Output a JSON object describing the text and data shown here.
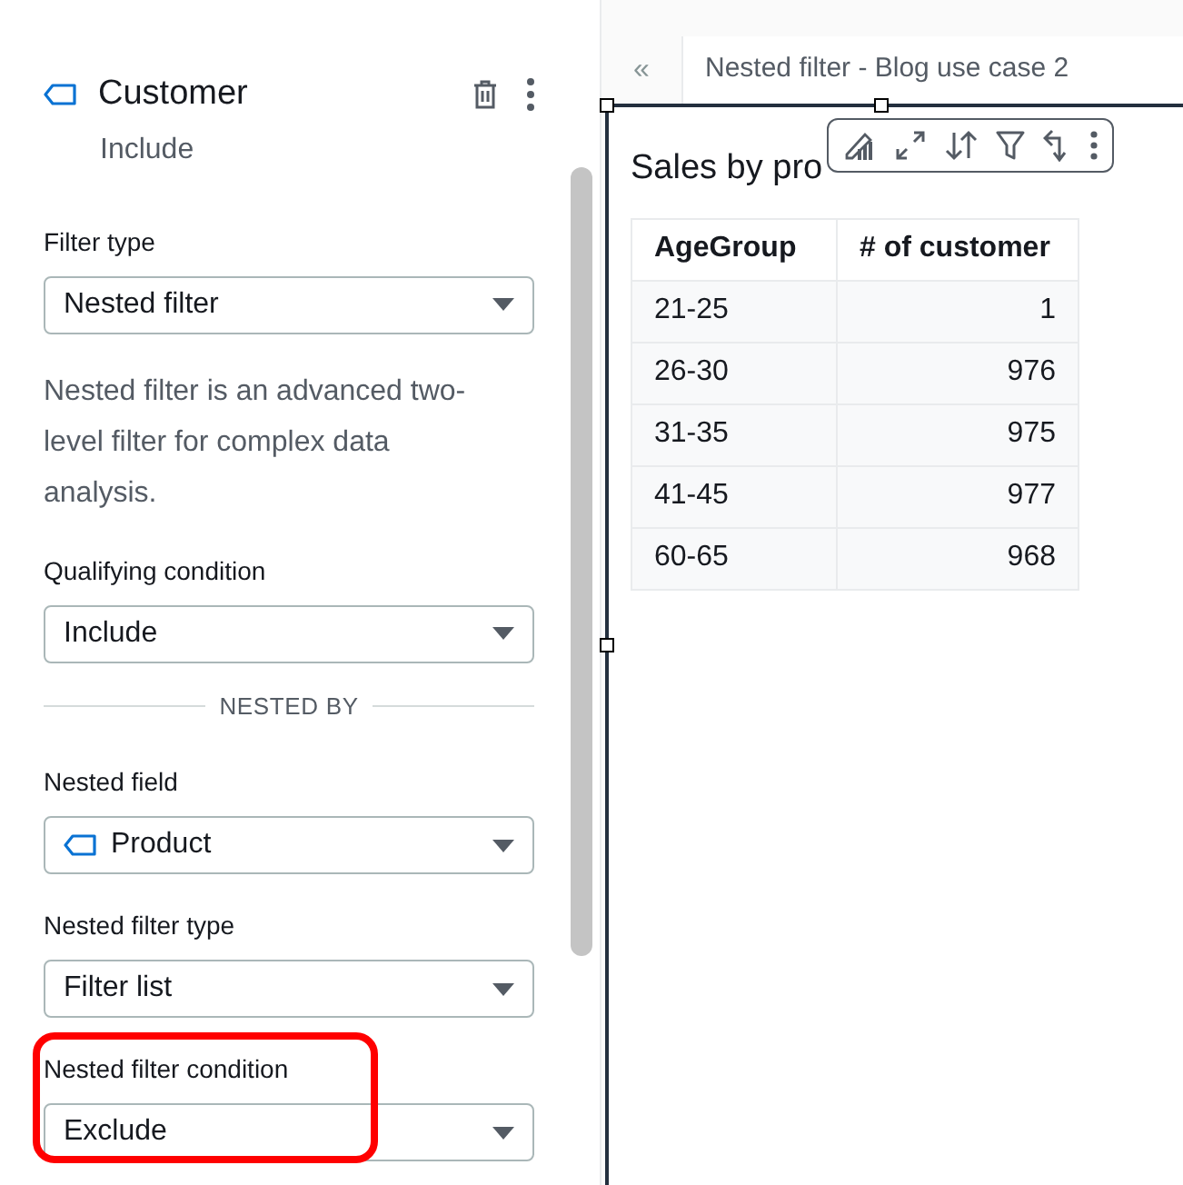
{
  "filter_header": {
    "title": "Customer",
    "subtitle": "Include"
  },
  "form": [
    {
      "kind": "select",
      "label": "Filter type",
      "value": "Nested filter",
      "highlighted": false
    },
    {
      "kind": "note",
      "text": "Nested filter is an advanced two-level filter for complex data analysis."
    },
    {
      "kind": "select",
      "label": "Qualifying condition",
      "value": "Include",
      "highlighted": false
    },
    {
      "kind": "divider",
      "text": "NESTED BY"
    },
    {
      "kind": "field-select",
      "label": "Nested field",
      "value": "Product",
      "highlighted": false
    },
    {
      "kind": "select",
      "label": "Nested filter type",
      "value": "Filter list",
      "highlighted": false
    },
    {
      "kind": "select",
      "label": "Nested filter condition",
      "value": "Exclude",
      "highlighted": true
    }
  ],
  "sheet_tab": {
    "collapse": "«",
    "title": "Nested filter - Blog use case 2"
  },
  "visual": {
    "title": "Sales by pro",
    "table": {
      "columns": [
        "AgeGroup",
        "# of customer"
      ],
      "rows": [
        [
          "21-25",
          "1"
        ],
        [
          "26-30",
          "976"
        ],
        [
          "31-35",
          "975"
        ],
        [
          "41-45",
          "977"
        ],
        [
          "60-65",
          "968"
        ]
      ]
    }
  }
}
